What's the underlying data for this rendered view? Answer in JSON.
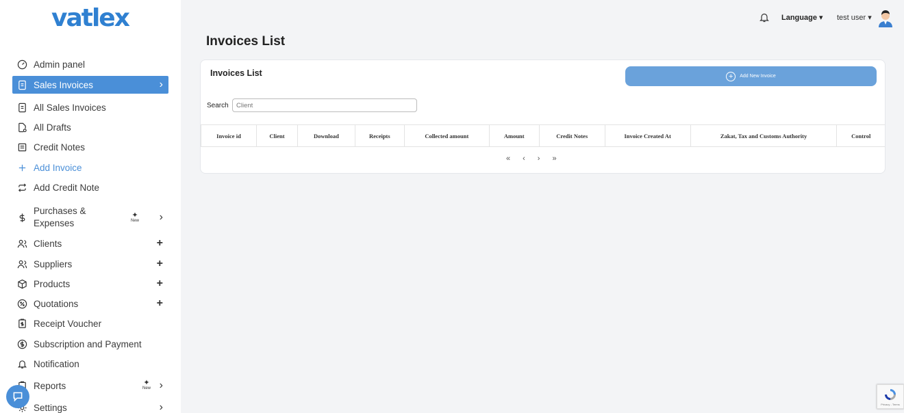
{
  "app": {
    "logo_text": "vatlex"
  },
  "sidebar": {
    "items": [
      {
        "label": "Admin panel",
        "icon": "dashboard-icon"
      },
      {
        "label": "Sales Invoices",
        "icon": "invoice-icon",
        "active": true
      },
      {
        "label": "All Sales Invoices",
        "icon": "file-icon"
      },
      {
        "label": "All Drafts",
        "icon": "draft-icon"
      },
      {
        "label": "Credit Notes",
        "icon": "note-icon"
      },
      {
        "label": "Add Invoice",
        "icon": "plus-icon"
      },
      {
        "label": "Add Credit Note",
        "icon": "repeat-icon"
      },
      {
        "label": "Purchases & Expenses",
        "icon": "dollar-icon"
      },
      {
        "label": "Clients",
        "icon": "users-icon"
      },
      {
        "label": "Suppliers",
        "icon": "users-icon"
      },
      {
        "label": "Products",
        "icon": "box-icon"
      },
      {
        "label": "Quotations",
        "icon": "percent-icon"
      },
      {
        "label": "Receipt Voucher",
        "icon": "receipt-icon"
      },
      {
        "label": "Subscription and Payment",
        "icon": "coin-icon"
      },
      {
        "label": "Notification",
        "icon": "bell-icon"
      },
      {
        "label": "Reports",
        "icon": "report-icon"
      },
      {
        "label": "Settings",
        "icon": "gear-icon"
      }
    ],
    "new_badge": "New",
    "plus_symbol": "+",
    "chevron": "›"
  },
  "topbar": {
    "language_label": "Language",
    "user_label": "test user",
    "caret": "▾"
  },
  "page": {
    "title": "Invoices List"
  },
  "card": {
    "title": "Invoices List",
    "add_button_label": "Add New Invoice",
    "search_label": "Search",
    "search_placeholder": "Client"
  },
  "table": {
    "columns": [
      "Invoice id",
      "Client",
      "Download",
      "Receipts",
      "Collected amount",
      "Amount",
      "Credit Notes",
      "Invoice Created At",
      "Zakat, Tax and Customs Authority",
      "Control"
    ]
  },
  "pagination": {
    "first": "«",
    "prev": "‹",
    "next": "›",
    "last": "»"
  },
  "recaptcha": {
    "text": "Privacy - Terms"
  },
  "colors": {
    "accent": "#4a8fd8",
    "button": "#6aa2db",
    "logo": "#2f80d1"
  }
}
